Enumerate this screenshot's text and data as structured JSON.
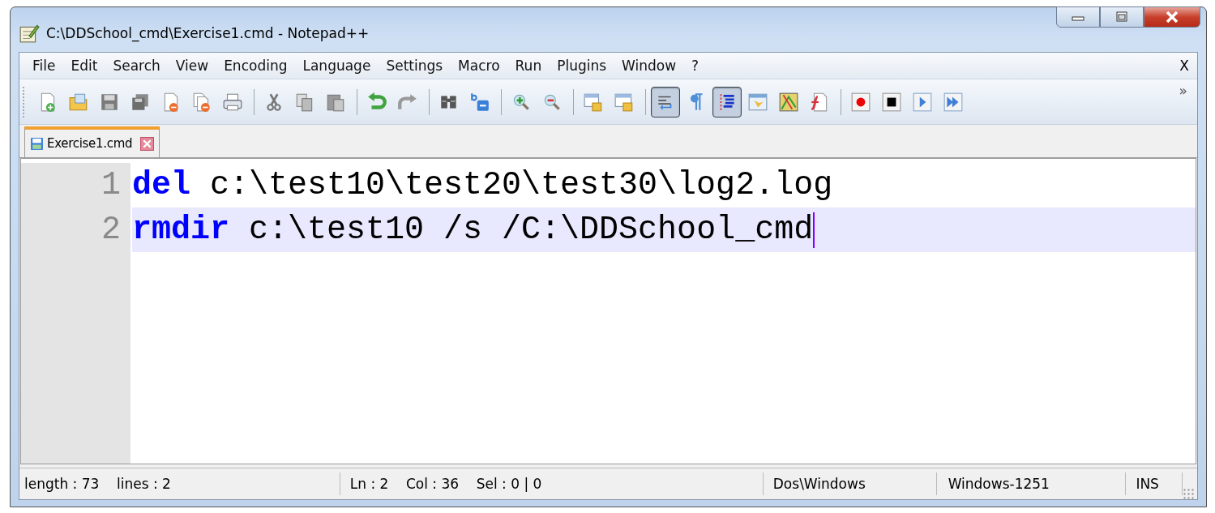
{
  "window": {
    "title": "C:\\DDSchool_cmd\\Exercise1.cmd - Notepad++"
  },
  "menu": [
    {
      "label": "File"
    },
    {
      "label": "Edit"
    },
    {
      "label": "Search"
    },
    {
      "label": "View"
    },
    {
      "label": "Encoding"
    },
    {
      "label": "Language"
    },
    {
      "label": "Settings"
    },
    {
      "label": "Macro"
    },
    {
      "label": "Run"
    },
    {
      "label": "Plugins"
    },
    {
      "label": "Window"
    },
    {
      "label": "?"
    }
  ],
  "menu_close": "X",
  "toolbar_groups": [
    [
      {
        "kind": "new",
        "on": false
      },
      {
        "kind": "open",
        "on": false
      },
      {
        "kind": "save",
        "on": false
      },
      {
        "kind": "save-all",
        "on": false
      },
      {
        "kind": "close",
        "on": false
      },
      {
        "kind": "close-all",
        "on": false
      },
      {
        "kind": "print",
        "on": false
      }
    ],
    [
      {
        "kind": "cut",
        "on": false
      },
      {
        "kind": "copy",
        "on": false
      },
      {
        "kind": "paste",
        "on": false
      }
    ],
    [
      {
        "kind": "undo",
        "on": false
      },
      {
        "kind": "redo",
        "on": false
      }
    ],
    [
      {
        "kind": "find",
        "on": false
      },
      {
        "kind": "replace",
        "on": false
      }
    ],
    [
      {
        "kind": "zoom-in",
        "on": false
      },
      {
        "kind": "zoom-out",
        "on": false
      }
    ],
    [
      {
        "kind": "sync-vertical",
        "on": false
      },
      {
        "kind": "sync-horizontal",
        "on": false
      }
    ],
    [
      {
        "kind": "word-wrap",
        "on": true
      },
      {
        "kind": "pilcrow",
        "on": false
      },
      {
        "kind": "indent-guide",
        "on": true
      },
      {
        "kind": "language",
        "on": false
      },
      {
        "kind": "document-map",
        "on": false
      },
      {
        "kind": "function-list",
        "on": false
      }
    ],
    [
      {
        "kind": "record",
        "on": false
      },
      {
        "kind": "stop",
        "on": false
      },
      {
        "kind": "play",
        "on": false
      },
      {
        "kind": "play-multiple",
        "on": false
      }
    ]
  ],
  "toolbar_overflow": "»",
  "tabs": [
    {
      "label": "Exercise1.cmd",
      "selected": true
    }
  ],
  "editor": {
    "lines": [
      {
        "number": "1",
        "current": false,
        "caret": false,
        "tokens": [
          {
            "kind": "keyword",
            "text": "del"
          },
          {
            "kind": "plain",
            "text": " c:\\test10\\test20\\test30\\log2.log"
          }
        ]
      },
      {
        "number": "2",
        "current": true,
        "caret": true,
        "tokens": [
          {
            "kind": "keyword",
            "text": "rmdir"
          },
          {
            "kind": "plain",
            "text": " c:\\test10 /s /C:\\DDSchool_cmd"
          }
        ]
      }
    ]
  },
  "status_bar": [
    {
      "text": "length : 73    lines : 2"
    },
    {
      "text": "Ln : 2    Col : 36    Sel : 0 | 0"
    },
    {
      "text": "Dos\\Windows"
    },
    {
      "text": "Windows-1251"
    },
    {
      "text": "INS"
    }
  ]
}
